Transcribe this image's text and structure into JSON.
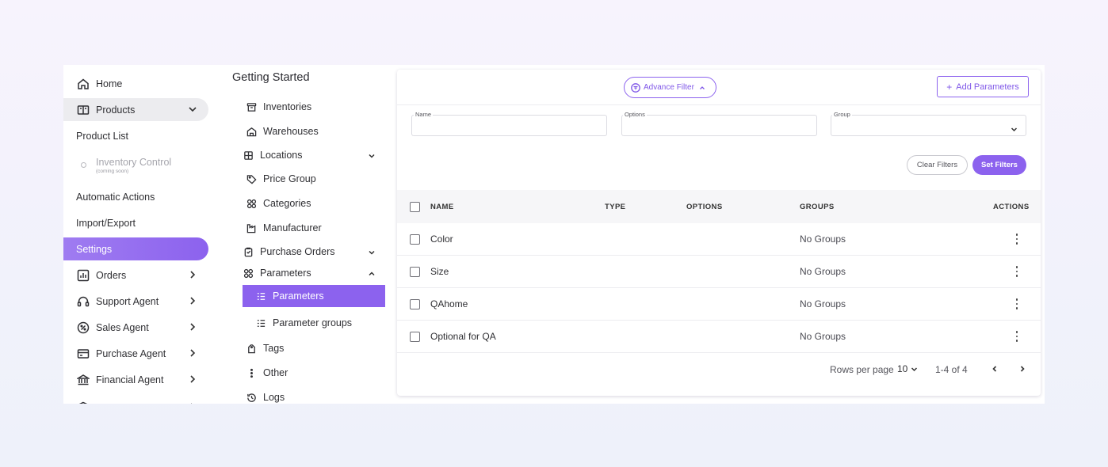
{
  "sidebar": {
    "items": [
      {
        "label": "Home",
        "icon": "home-icon"
      },
      {
        "label": "Products",
        "icon": "book-icon"
      },
      {
        "label": "Product List"
      },
      {
        "label": "Inventory Control",
        "note": "(coming soon)"
      },
      {
        "label": "Automatic Actions"
      },
      {
        "label": "Import/Export"
      },
      {
        "label": "Settings"
      },
      {
        "label": "Orders",
        "icon": "chart-icon"
      },
      {
        "label": "Support Agent",
        "icon": "headset-icon"
      },
      {
        "label": "Sales Agent",
        "icon": "badge-percent-icon"
      },
      {
        "label": "Purchase Agent",
        "icon": "credit-card-icon"
      },
      {
        "label": "Financial Agent",
        "icon": "bank-icon"
      }
    ]
  },
  "settings_nav": {
    "title": "Getting Started",
    "items": [
      {
        "label": "Inventories"
      },
      {
        "label": "Warehouses"
      },
      {
        "label": "Locations"
      },
      {
        "label": "Price Group"
      },
      {
        "label": "Categories"
      },
      {
        "label": "Manufacturer"
      },
      {
        "label": "Purchase Orders"
      },
      {
        "label": "Parameters"
      },
      {
        "label": "Parameters"
      },
      {
        "label": "Parameter groups"
      },
      {
        "label": "Tags"
      },
      {
        "label": "Other"
      },
      {
        "label": "Logs"
      }
    ]
  },
  "toolbar": {
    "advance_filter": "Advance Filter",
    "add_parameters": "Add Parameters"
  },
  "filters": {
    "name_label": "Name",
    "options_label": "Options",
    "group_label": "Group",
    "clear": "Clear Filters",
    "set": "Set Filters"
  },
  "table": {
    "columns": [
      "NAME",
      "TYPE",
      "OPTIONS",
      "GROUPS",
      "ACTIONS"
    ],
    "rows": [
      {
        "name": "Color",
        "type": "",
        "options": "",
        "groups": "No Groups"
      },
      {
        "name": "Size",
        "type": "",
        "options": "",
        "groups": "No Groups"
      },
      {
        "name": "QAhome",
        "type": "",
        "options": "",
        "groups": "No Groups"
      },
      {
        "name": "Optional for QA",
        "type": "",
        "options": "",
        "groups": "No Groups"
      }
    ]
  },
  "pagination": {
    "rows_per_page_label": "Rows per page",
    "rows_per_page": "10",
    "range": "1-4 of 4"
  },
  "colors": {
    "accent": "#8c62ee",
    "background": "#f4f2fc"
  }
}
